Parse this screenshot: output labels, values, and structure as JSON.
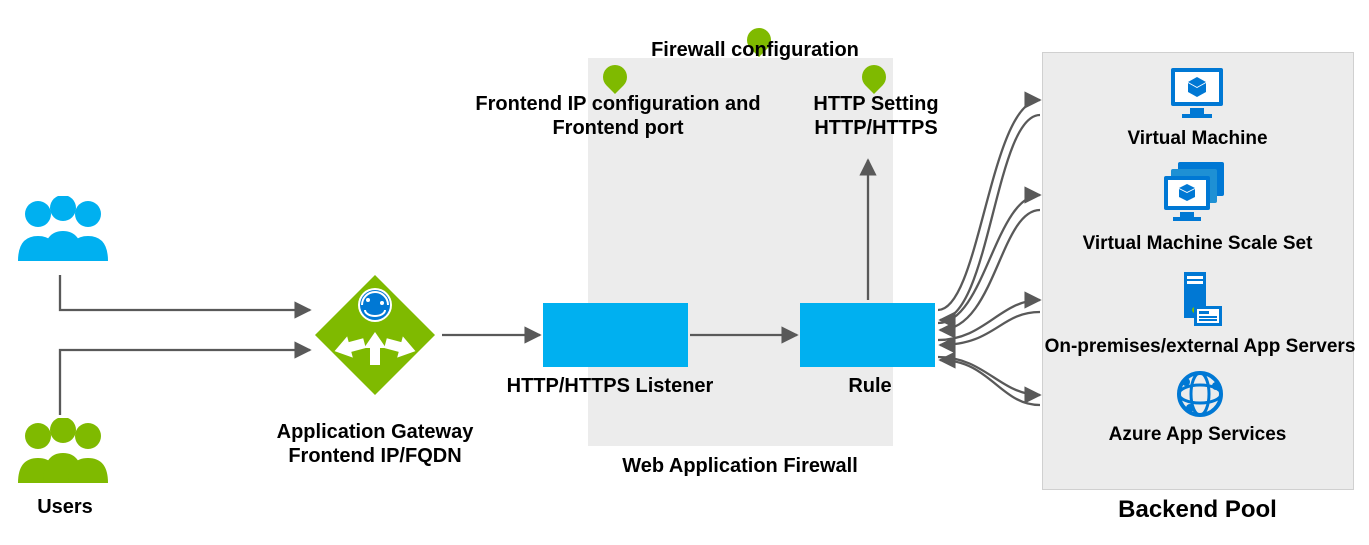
{
  "labels": {
    "users": "Users",
    "app_gateway_l1": "Application Gateway",
    "app_gateway_l2": "Frontend IP/FQDN",
    "firewall_conf": "Firewall configuration",
    "frontend_ip_l1": "Frontend IP configuration and",
    "frontend_ip_l2": "Frontend port",
    "http_setting_l1": "HTTP Setting",
    "http_setting_l2": "HTTP/HTTPS",
    "listener": "HTTP/HTTPS Listener",
    "rule": "Rule",
    "waf": "Web Application Firewall",
    "backend_pool": "Backend Pool",
    "vm": "Virtual Machine",
    "vmss": "Virtual Machine Scale Set",
    "onprem": "On-premises/external App Servers",
    "app_services": "Azure App Services"
  },
  "colors": {
    "azure_blue": "#0078D4",
    "cyan": "#00B0F0",
    "green": "#7FBA00",
    "panel": "#ECECEC"
  }
}
